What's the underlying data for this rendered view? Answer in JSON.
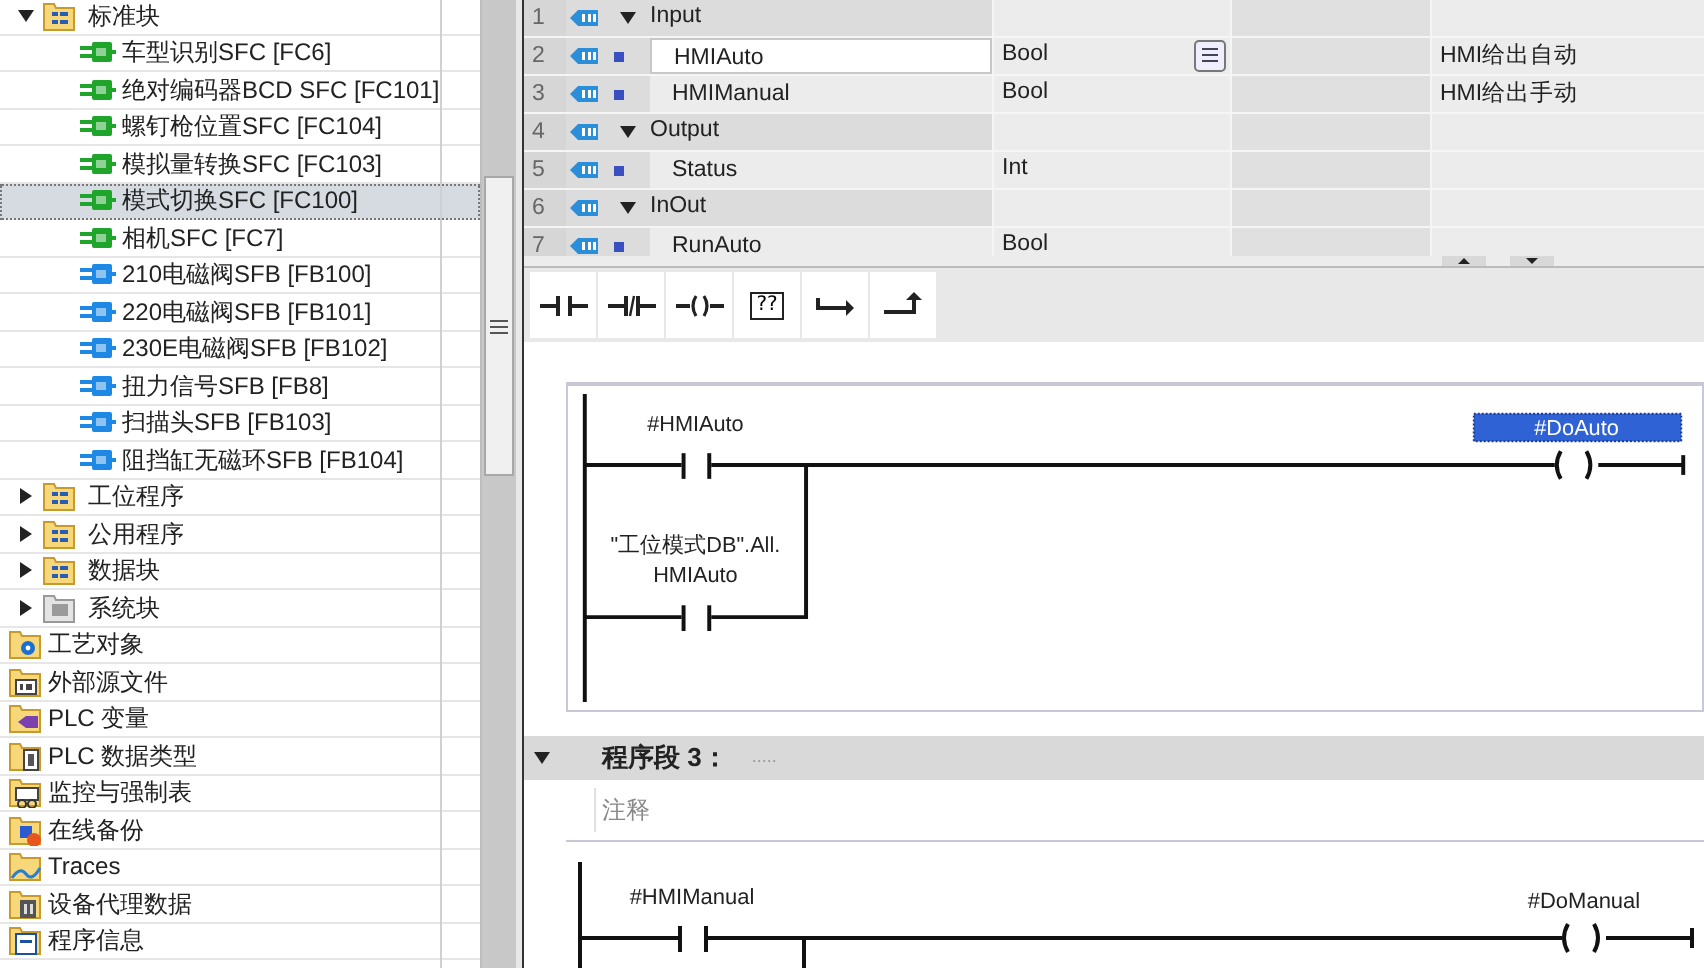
{
  "tree": {
    "groups": [
      {
        "label": "标准块",
        "kind": "program",
        "expanded": true,
        "children": [
          {
            "label": "车型识别SFC [FC6]",
            "kind": "fc",
            "selected": false
          },
          {
            "label": "绝对编码器BCD SFC [FC101]",
            "kind": "fc",
            "selected": false
          },
          {
            "label": "螺钉枪位置SFC [FC104]",
            "kind": "fc",
            "selected": false
          },
          {
            "label": "模拟量转换SFC [FC103]",
            "kind": "fc",
            "selected": false
          },
          {
            "label": "模式切换SFC [FC100]",
            "kind": "fc",
            "selected": true
          },
          {
            "label": "相机SFC [FC7]",
            "kind": "fc",
            "selected": false
          },
          {
            "label": "210电磁阀SFB [FB100]",
            "kind": "fb",
            "selected": false
          },
          {
            "label": "220电磁阀SFB [FB101]",
            "kind": "fb",
            "selected": false
          },
          {
            "label": "230E电磁阀SFB [FB102]",
            "kind": "fb",
            "selected": false
          },
          {
            "label": "扭力信号SFB [FB8]",
            "kind": "fb",
            "selected": false
          },
          {
            "label": "扫描头SFB [FB103]",
            "kind": "fb",
            "selected": false
          },
          {
            "label": "阻挡缸无磁环SFB [FB104]",
            "kind": "fb",
            "selected": false
          }
        ]
      },
      {
        "label": "工位程序",
        "kind": "program",
        "expanded": false
      },
      {
        "label": "公用程序",
        "kind": "program",
        "expanded": false
      },
      {
        "label": "数据块",
        "kind": "program",
        "expanded": false
      },
      {
        "label": "系统块",
        "kind": "system",
        "expanded": false
      }
    ],
    "items": [
      {
        "label": "工艺对象",
        "kind": "technology"
      },
      {
        "label": "外部源文件",
        "kind": "external"
      },
      {
        "label": "PLC 变量",
        "kind": "tags"
      },
      {
        "label": "PLC 数据类型",
        "kind": "datatypes"
      },
      {
        "label": "监控与强制表",
        "kind": "watch"
      },
      {
        "label": "在线备份",
        "kind": "backup"
      },
      {
        "label": "Traces",
        "kind": "traces"
      },
      {
        "label": "设备代理数据",
        "kind": "proxy"
      },
      {
        "label": "程序信息",
        "kind": "info"
      }
    ]
  },
  "interface_table": {
    "rows": [
      {
        "number": "1",
        "kind": "section",
        "name": "Input",
        "expanded": true
      },
      {
        "number": "2",
        "kind": "variable",
        "name": "HMIAuto",
        "type": "Bool",
        "comment": "HMI给出自动",
        "selected": true
      },
      {
        "number": "3",
        "kind": "variable",
        "name": "HMIManual",
        "type": "Bool",
        "comment": "HMI给出手动",
        "selected": false
      },
      {
        "number": "4",
        "kind": "section",
        "name": "Output",
        "expanded": true
      },
      {
        "number": "5",
        "kind": "variable",
        "name": "Status",
        "type": "Int",
        "selected": false
      },
      {
        "number": "6",
        "kind": "section",
        "name": "InOut",
        "expanded": true
      },
      {
        "number": "7",
        "kind": "variable",
        "name": "RunAuto",
        "type": "Bool",
        "selected": false
      }
    ]
  },
  "toolbar": [
    {
      "kind": "no-contact"
    },
    {
      "kind": "nc-contact"
    },
    {
      "kind": "coil"
    },
    {
      "kind": "box",
      "label": "??"
    },
    {
      "kind": "open-branch"
    },
    {
      "kind": "close-branch"
    }
  ],
  "networks": [
    {
      "contact": "#HMIAuto",
      "parallel_contact": [
        "\"工位模式DB\".All.",
        "HMIAuto"
      ],
      "coil": "#DoAuto",
      "coil_selected": true
    },
    {
      "title": "程序段 3：",
      "title_placeholder": ".....",
      "comment_placeholder": "注释",
      "contact": "#HMIManual",
      "coil": "#DoManual",
      "coil_selected": false,
      "expanded": true
    }
  ]
}
